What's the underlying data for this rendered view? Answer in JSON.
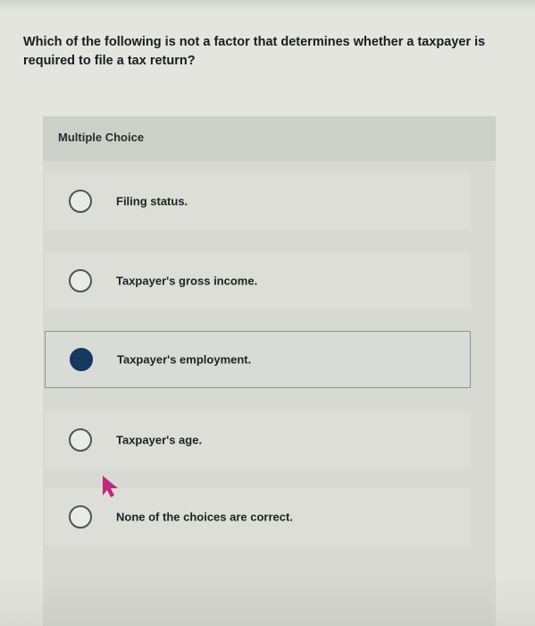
{
  "question": {
    "text": "Which of the following is not a factor that determines whether a taxpayer is required to file a tax return?"
  },
  "section": {
    "label": "Multiple Choice"
  },
  "options": [
    {
      "label": "Filing status.",
      "selected": false
    },
    {
      "label": "Taxpayer's gross income.",
      "selected": false
    },
    {
      "label": "Taxpayer's employment.",
      "selected": true
    },
    {
      "label": "Taxpayer's age.",
      "selected": false
    },
    {
      "label": "None of the choices are correct.",
      "selected": false
    }
  ],
  "colors": {
    "selected_radio": "#17385f",
    "cursor": "#c0297a"
  },
  "icons": {
    "pointer": "mouse-pointer-icon"
  }
}
